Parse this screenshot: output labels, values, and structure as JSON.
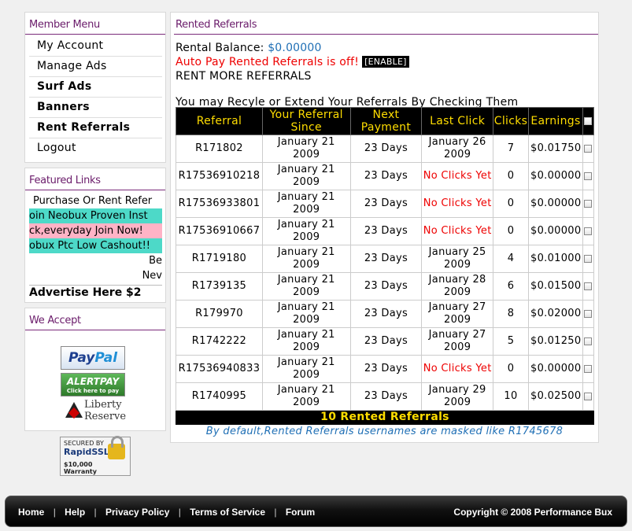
{
  "member_menu": {
    "title": "Member Menu",
    "items": [
      {
        "label": "My Account",
        "bold": false
      },
      {
        "label": "Manage Ads",
        "bold": false
      },
      {
        "label": "Surf Ads",
        "bold": true
      },
      {
        "label": "Banners",
        "bold": true
      },
      {
        "label": "Rent Referrals",
        "bold": true
      },
      {
        "label": "Logout",
        "bold": false
      }
    ]
  },
  "featured_links": {
    "title": "Featured Links",
    "rows": [
      "Purchase Or Rent Refer",
      "oin Neobux Proven Inst",
      "ck,everyday Join Now!",
      "obux Ptc Low Cashout!!",
      "Be",
      "Nev"
    ],
    "advertise": "Advertise Here $2"
  },
  "we_accept": {
    "title": "We Accept",
    "paypal": {
      "pay": "Pay",
      "pal": "Pal"
    },
    "alertpay": {
      "name": "ALERTPAY",
      "sub": "Click here to pay"
    },
    "liberty": {
      "line1": "Liberty",
      "line2": "Reserve"
    }
  },
  "ssl_badge": {
    "line1": "SECURED BY",
    "line2": "RapidSSL",
    "line3": "$10,000 Warranty"
  },
  "main": {
    "title": "Rented Referrals",
    "balance_label": "Rental Balance:",
    "balance_value": "$0.00000",
    "autopay_text": "Auto Pay Rented Referrals is off!",
    "enable_label": "[ENABLE]",
    "rent_more": "RENT MORE REFERRALS",
    "recycle_text": "You may Recyle or Extend Your Referrals By Checking Them",
    "columns": [
      "Referral",
      "Your Referral Since",
      "Next Payment",
      "Last Click",
      "Clicks",
      "Earnings"
    ],
    "rows": [
      {
        "referral": "R171802",
        "since": "January 21 2009",
        "next": "23 Days",
        "last": "January 26 2009",
        "noclick": false,
        "clicks": "7",
        "earnings": "$0.01750"
      },
      {
        "referral": "R17536910218",
        "since": "January 21 2009",
        "next": "23 Days",
        "last": "No Clicks Yet",
        "noclick": true,
        "clicks": "0",
        "earnings": "$0.00000"
      },
      {
        "referral": "R17536933801",
        "since": "January 21 2009",
        "next": "23 Days",
        "last": "No Clicks Yet",
        "noclick": true,
        "clicks": "0",
        "earnings": "$0.00000"
      },
      {
        "referral": "R17536910667",
        "since": "January 21 2009",
        "next": "23 Days",
        "last": "No Clicks Yet",
        "noclick": true,
        "clicks": "0",
        "earnings": "$0.00000"
      },
      {
        "referral": "R1719180",
        "since": "January 21 2009",
        "next": "23 Days",
        "last": "January 25 2009",
        "noclick": false,
        "clicks": "4",
        "earnings": "$0.01000"
      },
      {
        "referral": "R1739135",
        "since": "January 21 2009",
        "next": "23 Days",
        "last": "January 28 2009",
        "noclick": false,
        "clicks": "6",
        "earnings": "$0.01500"
      },
      {
        "referral": "R179970",
        "since": "January 21 2009",
        "next": "23 Days",
        "last": "January 27 2009",
        "noclick": false,
        "clicks": "8",
        "earnings": "$0.02000"
      },
      {
        "referral": "R1742222",
        "since": "January 21 2009",
        "next": "23 Days",
        "last": "January 27 2009",
        "noclick": false,
        "clicks": "5",
        "earnings": "$0.01250"
      },
      {
        "referral": "R17536940833",
        "since": "January 21 2009",
        "next": "23 Days",
        "last": "No Clicks Yet",
        "noclick": true,
        "clicks": "0",
        "earnings": "$0.00000"
      },
      {
        "referral": "R1740995",
        "since": "January 21 2009",
        "next": "23 Days",
        "last": "January 29 2009",
        "noclick": false,
        "clicks": "10",
        "earnings": "$0.02500"
      }
    ],
    "total_label": "10 Rented Referrals",
    "note": "By default,Rented Referrals usernames are masked like R1745678"
  },
  "footer": {
    "links": [
      "Home",
      "Help",
      "Privacy Policy",
      "Terms of Service",
      "Forum"
    ],
    "separator": "|",
    "copyright": "Copyright © 2008 Performance Bux"
  }
}
